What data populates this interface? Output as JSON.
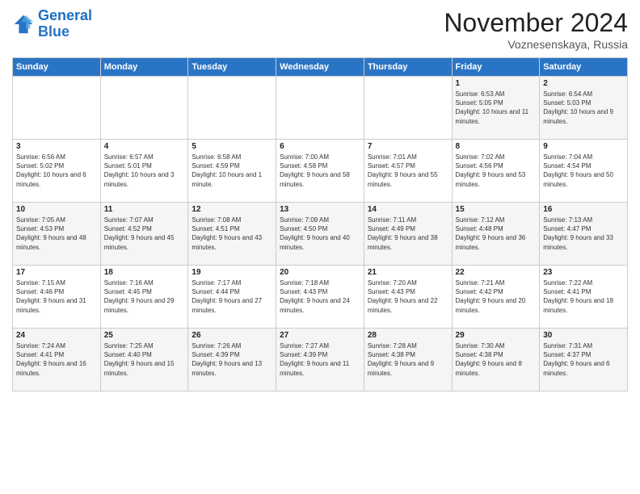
{
  "logo": {
    "line1": "General",
    "line2": "Blue"
  },
  "title": "November 2024",
  "subtitle": "Voznesenskaya, Russia",
  "days_of_week": [
    "Sunday",
    "Monday",
    "Tuesday",
    "Wednesday",
    "Thursday",
    "Friday",
    "Saturday"
  ],
  "weeks": [
    [
      {
        "day": "",
        "info": ""
      },
      {
        "day": "",
        "info": ""
      },
      {
        "day": "",
        "info": ""
      },
      {
        "day": "",
        "info": ""
      },
      {
        "day": "",
        "info": ""
      },
      {
        "day": "1",
        "info": "Sunrise: 6:53 AM\nSunset: 5:05 PM\nDaylight: 10 hours and 11 minutes."
      },
      {
        "day": "2",
        "info": "Sunrise: 6:54 AM\nSunset: 5:03 PM\nDaylight: 10 hours and 9 minutes."
      }
    ],
    [
      {
        "day": "3",
        "info": "Sunrise: 6:56 AM\nSunset: 5:02 PM\nDaylight: 10 hours and 6 minutes."
      },
      {
        "day": "4",
        "info": "Sunrise: 6:57 AM\nSunset: 5:01 PM\nDaylight: 10 hours and 3 minutes."
      },
      {
        "day": "5",
        "info": "Sunrise: 6:58 AM\nSunset: 4:59 PM\nDaylight: 10 hours and 1 minute."
      },
      {
        "day": "6",
        "info": "Sunrise: 7:00 AM\nSunset: 4:58 PM\nDaylight: 9 hours and 58 minutes."
      },
      {
        "day": "7",
        "info": "Sunrise: 7:01 AM\nSunset: 4:57 PM\nDaylight: 9 hours and 55 minutes."
      },
      {
        "day": "8",
        "info": "Sunrise: 7:02 AM\nSunset: 4:56 PM\nDaylight: 9 hours and 53 minutes."
      },
      {
        "day": "9",
        "info": "Sunrise: 7:04 AM\nSunset: 4:54 PM\nDaylight: 9 hours and 50 minutes."
      }
    ],
    [
      {
        "day": "10",
        "info": "Sunrise: 7:05 AM\nSunset: 4:53 PM\nDaylight: 9 hours and 48 minutes."
      },
      {
        "day": "11",
        "info": "Sunrise: 7:07 AM\nSunset: 4:52 PM\nDaylight: 9 hours and 45 minutes."
      },
      {
        "day": "12",
        "info": "Sunrise: 7:08 AM\nSunset: 4:51 PM\nDaylight: 9 hours and 43 minutes."
      },
      {
        "day": "13",
        "info": "Sunrise: 7:09 AM\nSunset: 4:50 PM\nDaylight: 9 hours and 40 minutes."
      },
      {
        "day": "14",
        "info": "Sunrise: 7:11 AM\nSunset: 4:49 PM\nDaylight: 9 hours and 38 minutes."
      },
      {
        "day": "15",
        "info": "Sunrise: 7:12 AM\nSunset: 4:48 PM\nDaylight: 9 hours and 36 minutes."
      },
      {
        "day": "16",
        "info": "Sunrise: 7:13 AM\nSunset: 4:47 PM\nDaylight: 9 hours and 33 minutes."
      }
    ],
    [
      {
        "day": "17",
        "info": "Sunrise: 7:15 AM\nSunset: 4:46 PM\nDaylight: 9 hours and 31 minutes."
      },
      {
        "day": "18",
        "info": "Sunrise: 7:16 AM\nSunset: 4:45 PM\nDaylight: 9 hours and 29 minutes."
      },
      {
        "day": "19",
        "info": "Sunrise: 7:17 AM\nSunset: 4:44 PM\nDaylight: 9 hours and 27 minutes."
      },
      {
        "day": "20",
        "info": "Sunrise: 7:18 AM\nSunset: 4:43 PM\nDaylight: 9 hours and 24 minutes."
      },
      {
        "day": "21",
        "info": "Sunrise: 7:20 AM\nSunset: 4:43 PM\nDaylight: 9 hours and 22 minutes."
      },
      {
        "day": "22",
        "info": "Sunrise: 7:21 AM\nSunset: 4:42 PM\nDaylight: 9 hours and 20 minutes."
      },
      {
        "day": "23",
        "info": "Sunrise: 7:22 AM\nSunset: 4:41 PM\nDaylight: 9 hours and 18 minutes."
      }
    ],
    [
      {
        "day": "24",
        "info": "Sunrise: 7:24 AM\nSunset: 4:41 PM\nDaylight: 9 hours and 16 minutes."
      },
      {
        "day": "25",
        "info": "Sunrise: 7:25 AM\nSunset: 4:40 PM\nDaylight: 9 hours and 15 minutes."
      },
      {
        "day": "26",
        "info": "Sunrise: 7:26 AM\nSunset: 4:39 PM\nDaylight: 9 hours and 13 minutes."
      },
      {
        "day": "27",
        "info": "Sunrise: 7:27 AM\nSunset: 4:39 PM\nDaylight: 9 hours and 11 minutes."
      },
      {
        "day": "28",
        "info": "Sunrise: 7:28 AM\nSunset: 4:38 PM\nDaylight: 9 hours and 9 minutes."
      },
      {
        "day": "29",
        "info": "Sunrise: 7:30 AM\nSunset: 4:38 PM\nDaylight: 9 hours and 8 minutes."
      },
      {
        "day": "30",
        "info": "Sunrise: 7:31 AM\nSunset: 4:37 PM\nDaylight: 9 hours and 6 minutes."
      }
    ]
  ]
}
